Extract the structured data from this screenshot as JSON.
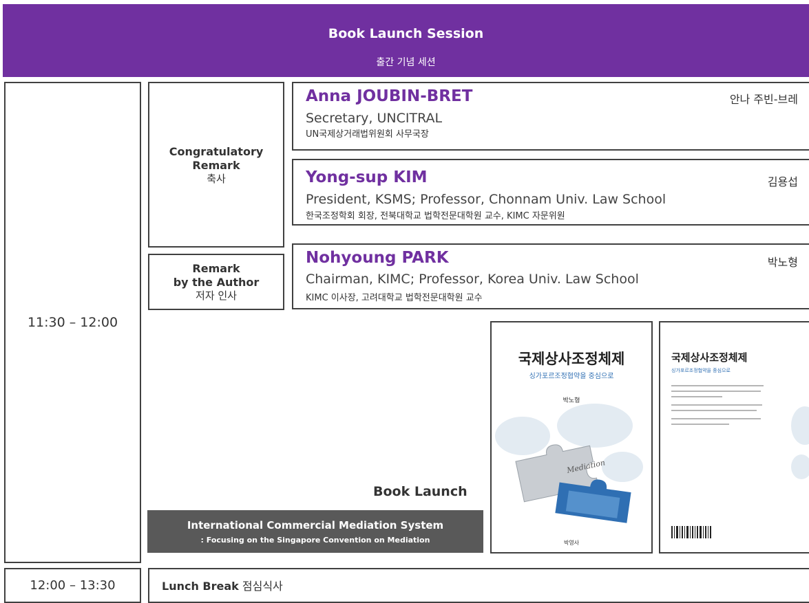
{
  "header": {
    "title": "Book Launch Session",
    "subtitle": "출간 기념 세션"
  },
  "session": {
    "time": "11:30 – 12:00",
    "congrats_label": {
      "en_line1": "Congratulatory",
      "en_line2": "Remark",
      "ko": "축사"
    },
    "author_label": {
      "en_line1": "Remark",
      "en_line2": "by the Author",
      "ko": "저자 인사"
    },
    "speakers": [
      {
        "name": "Anna JOUBIN-BRET",
        "name_ko": "안나 주빈-브레",
        "role": "Secretary, UNCITRAL",
        "role_ko": "UN국제상거래법위원회 사무국장"
      },
      {
        "name": "Yong-sup KIM",
        "name_ko": "김용섭",
        "role": "President, KSMS; Professor, Chonnam Univ. Law School",
        "role_ko": "한국조정학회 회장, 전북대학교 법학전문대학원 교수, KIMC 자문위원"
      },
      {
        "name": "Nohyoung PARK",
        "name_ko": "박노형",
        "role": "Chairman, KIMC; Professor, Korea Univ. Law School",
        "role_ko": "KIMC 이사장, 고려대학교 법학전문대학원 교수"
      }
    ],
    "book_launch": {
      "label": "Book Launch",
      "title_line1": "International Commercial Mediation System",
      "title_line2": ": Focusing on the Singapore Convention on Mediation"
    },
    "front_cover": {
      "title": "국제상사조정체제",
      "subtitle": "싱가포르조정협약을 중심으로",
      "author": "박노형",
      "puzzle_text": "Mediation",
      "publisher": "박영사"
    },
    "back_cover": {
      "title": "국제상사조정체제",
      "subtitle": "싱가포르조정협약을 중심으로"
    }
  },
  "lunch": {
    "time": "12:00 – 13:30",
    "label_en": "Lunch Break",
    "label_ko": "점심식사"
  }
}
